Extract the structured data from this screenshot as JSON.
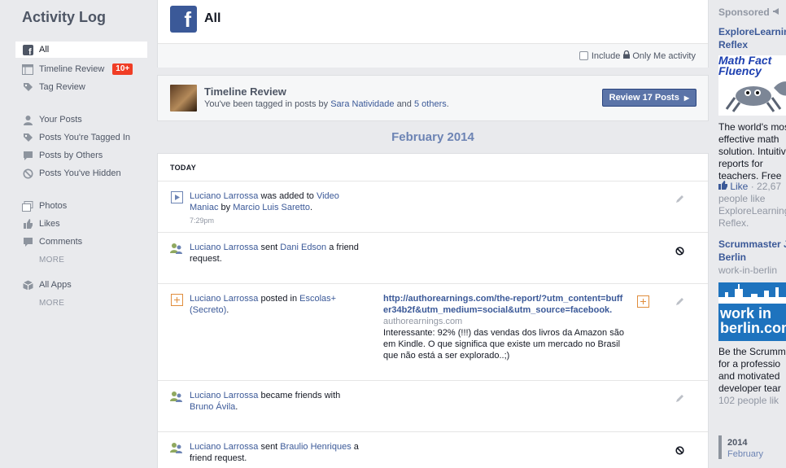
{
  "sidebar": {
    "title": "Activity Log",
    "items": [
      {
        "label": "All",
        "icon": "facebook-icon",
        "active": true
      },
      {
        "label": "Timeline Review",
        "icon": "timeline-icon",
        "badge": "10+"
      },
      {
        "label": "Tag Review",
        "icon": "tag-icon"
      },
      {
        "label": "Your Posts",
        "icon": "person-icon"
      },
      {
        "label": "Posts You're Tagged In",
        "icon": "tag-icon"
      },
      {
        "label": "Posts by Others",
        "icon": "speech-bubble-icon"
      },
      {
        "label": "Posts You've Hidden",
        "icon": "hidden-icon"
      },
      {
        "label": "Photos",
        "icon": "photos-icon"
      },
      {
        "label": "Likes",
        "icon": "thumbs-up-icon"
      },
      {
        "label": "Comments",
        "icon": "comment-icon"
      },
      {
        "label": "MORE"
      },
      {
        "label": "All Apps",
        "icon": "apps-icon"
      },
      {
        "label": "MORE"
      }
    ]
  },
  "header": {
    "logo": "f",
    "title": "All",
    "include_label": "Include",
    "only_me_label": "Only Me activity"
  },
  "review": {
    "title": "Timeline Review",
    "subtitle_prefix": "You've been tagged in posts by",
    "person": "Sara Natividade",
    "and": "and",
    "others": "5 others",
    "period": ".",
    "button": "Review 17 Posts",
    "button_arrow": "▶"
  },
  "feed": {
    "month": "February 2014",
    "today": "TODAY",
    "rows": [
      {
        "p1": "Luciano Larrossa",
        "t1": " was added to ",
        "p2": "Video Maniac",
        "t2": " by ",
        "p3": "Marcio Luis Saretto",
        "t3": ".",
        "time": "7:29pm"
      },
      {
        "p1": "Luciano Larrossa",
        "t1": " sent ",
        "p2": "Dani Edson",
        "t2": " a friend request."
      },
      {
        "p1": "Luciano Larrossa",
        "t1": " posted in ",
        "p2": "Escolas+ (Secreto)",
        "t2": ".",
        "attach_url": "http://authorearnings.com/the-report/?utm_content=buffer34b2f&utm_medium=social&utm_source=facebook.",
        "attach_domain": "authorearnings.com",
        "attach_desc": "Interessante: 92% (!!!) das vendas dos livros da Amazon são em Kindle. O que significa que existe um mercado no Brasil que não está a ser explorado..;)"
      },
      {
        "p1": "Luciano Larrossa",
        "t1": " became friends with ",
        "p2": "Bruno Ávila",
        "t2": "."
      },
      {
        "p1": "Luciano Larrossa",
        "t1": " sent ",
        "p2": "Braulio Henriques",
        "t2": " a friend request."
      }
    ]
  },
  "ads": {
    "sponsored": "Sponsored",
    "ad1": {
      "title": "ExploreLearning Reflex",
      "img_text": "Math Fact Fluency",
      "body": [
        "The world's most",
        "effective math",
        "solution. Intuitive",
        "reports for",
        "teachers. Free"
      ],
      "like": "Like",
      "like_count": "· 22,67",
      "people": [
        "people like",
        "ExploreLearning",
        "Reflex."
      ]
    },
    "ad2": {
      "title": "Scrummaster Job in Berlin",
      "domain": "work-in-berlin",
      "img_text": "work in berlin.com",
      "body": [
        "Be the Scrumm",
        "for a professio",
        "and motivated",
        "developer tear"
      ],
      "people": "102 people lik"
    },
    "year": "2014",
    "month": "February"
  },
  "colors": {
    "brand": "#3b5998",
    "badge": "#f03d25",
    "background": "#e9eaed",
    "month_heading": "#6d84b4"
  }
}
